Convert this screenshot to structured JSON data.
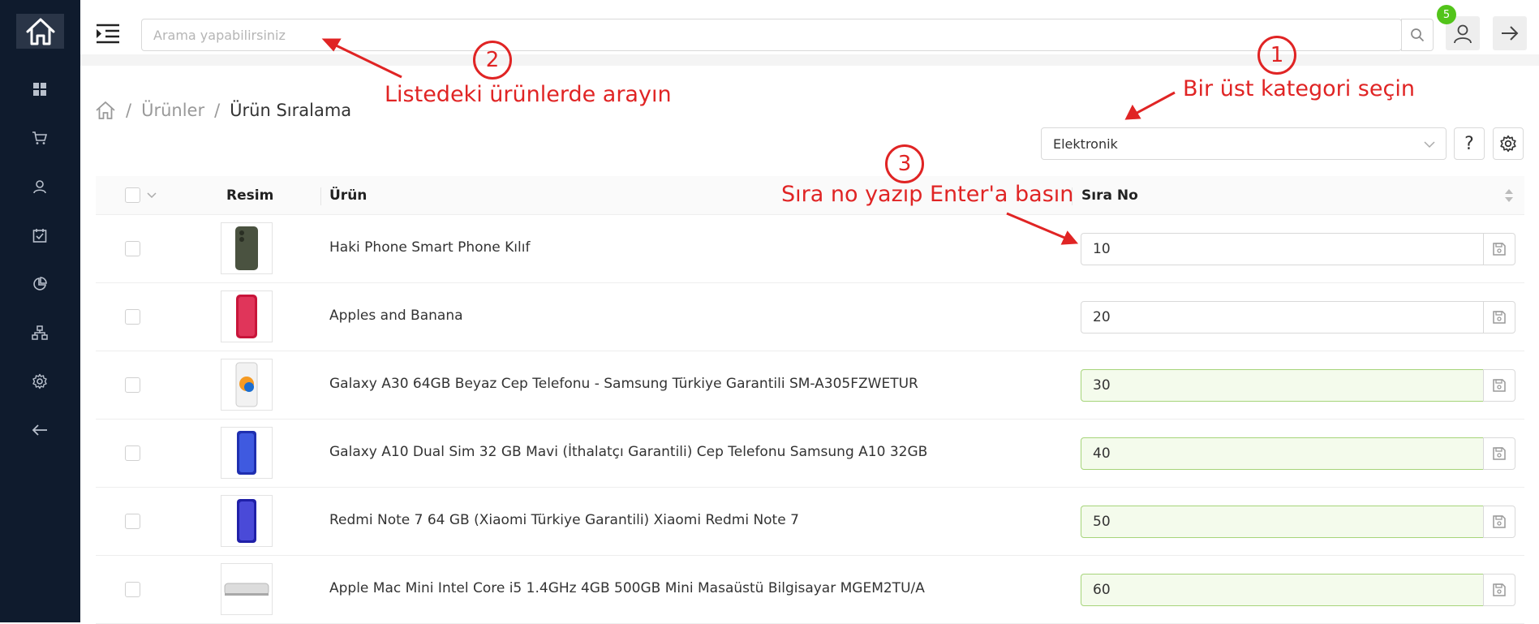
{
  "sidebar": {
    "items": [
      {
        "icon": "dashboard-icon"
      },
      {
        "icon": "cart-icon"
      },
      {
        "icon": "user-icon"
      },
      {
        "icon": "tasks-icon"
      },
      {
        "icon": "pie-chart-icon"
      },
      {
        "icon": "hierarchy-icon"
      },
      {
        "icon": "gear-icon"
      },
      {
        "icon": "back-arrow-icon"
      }
    ]
  },
  "header": {
    "search_placeholder": "Arama yapabilirsiniz",
    "search_value": "",
    "notification_count": "5"
  },
  "breadcrumb": {
    "sep1": "/",
    "item1": "Ürünler",
    "sep2": "/",
    "current": "Ürün Sıralama"
  },
  "toolbar": {
    "category_selected": "Elektronik",
    "help_label": "?"
  },
  "table": {
    "columns": {
      "image": "Resim",
      "product": "Ürün",
      "order": "Sıra No"
    },
    "rows": [
      {
        "name": "Haki Phone Smart Phone Kılıf",
        "order": "10",
        "modified": false
      },
      {
        "name": "Apples and Banana",
        "order": "20",
        "modified": false
      },
      {
        "name": "Galaxy A30 64GB Beyaz Cep Telefonu - Samsung Türkiye Garantili SM-A305FZWETUR",
        "order": "30",
        "modified": true
      },
      {
        "name": "Galaxy A10 Dual Sim 32 GB Mavi (İthalatçı Garantili) Cep Telefonu Samsung A10 32GB",
        "order": "40",
        "modified": true
      },
      {
        "name": "Redmi Note 7 64 GB (Xiaomi Türkiye Garantili) Xiaomi Redmi Note 7",
        "order": "50",
        "modified": true
      },
      {
        "name": "Apple Mac Mini Intel Core i5 1.4GHz 4GB 500GB Mini Masaüstü Bilgisayar MGEM2TU/A",
        "order": "60",
        "modified": true
      }
    ]
  },
  "annotations": {
    "n1": "1",
    "t1": "Bir üst kategori seçin",
    "n2": "2",
    "t2": "Listedeki ürünlerde arayın",
    "n3": "3",
    "t3": "Sıra no yazıp Enter'a basın",
    "color": "#e02424"
  }
}
